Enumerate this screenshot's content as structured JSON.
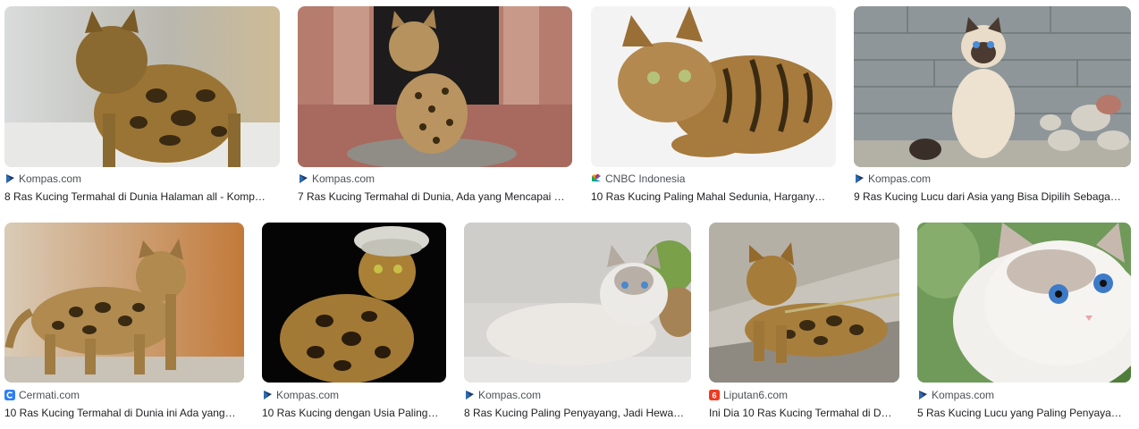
{
  "results": [
    {
      "source": "Kompas.com",
      "favicon": "kompas-icon",
      "title": "8 Ras Kucing Termahal di Dunia Halaman all - Komp…",
      "image": "bengal-cat-standing-photo"
    },
    {
      "source": "Kompas.com",
      "favicon": "kompas-icon",
      "title": "7 Ras Kucing Termahal di Dunia, Ada yang Mencapai …",
      "image": "spotted-kitten-sitting-photo"
    },
    {
      "source": "CNBC Indonesia",
      "favicon": "cnbc-icon",
      "title": "10 Ras Kucing Paling Mahal Sedunia, Hargany…",
      "image": "bengal-cat-lying-photo"
    },
    {
      "source": "Kompas.com",
      "favicon": "kompas-icon",
      "title": "9 Ras Kucing Lucu dari Asia yang Bisa Dipilih Sebaga…",
      "image": "siamese-cat-sitting-photo"
    },
    {
      "source": "Cermati.com",
      "favicon": "cermati-icon",
      "title": "10 Ras Kucing Termahal di Dunia ini Ada yang…",
      "image": "bengal-cat-walking-photo"
    },
    {
      "source": "Kompas.com",
      "favicon": "kompas-icon",
      "title": "10 Ras Kucing dengan Usia Paling…",
      "image": "bengal-cat-hat-photo"
    },
    {
      "source": "Kompas.com",
      "favicon": "kompas-icon",
      "title": "8 Ras Kucing Paling Penyayang, Jadi Hewa…",
      "image": "ragdoll-cat-lying-photo"
    },
    {
      "source": "Liputan6.com",
      "favicon": "liputan6-icon",
      "title": "Ini Dia 10 Ras Kucing Termahal di D…",
      "image": "leashed-bengal-cat-photo"
    },
    {
      "source": "Kompas.com",
      "favicon": "kompas-icon",
      "title": "5 Ras Kucing Lucu yang Paling Penyaya…",
      "image": "white-blue-eyed-cat-photo"
    }
  ]
}
